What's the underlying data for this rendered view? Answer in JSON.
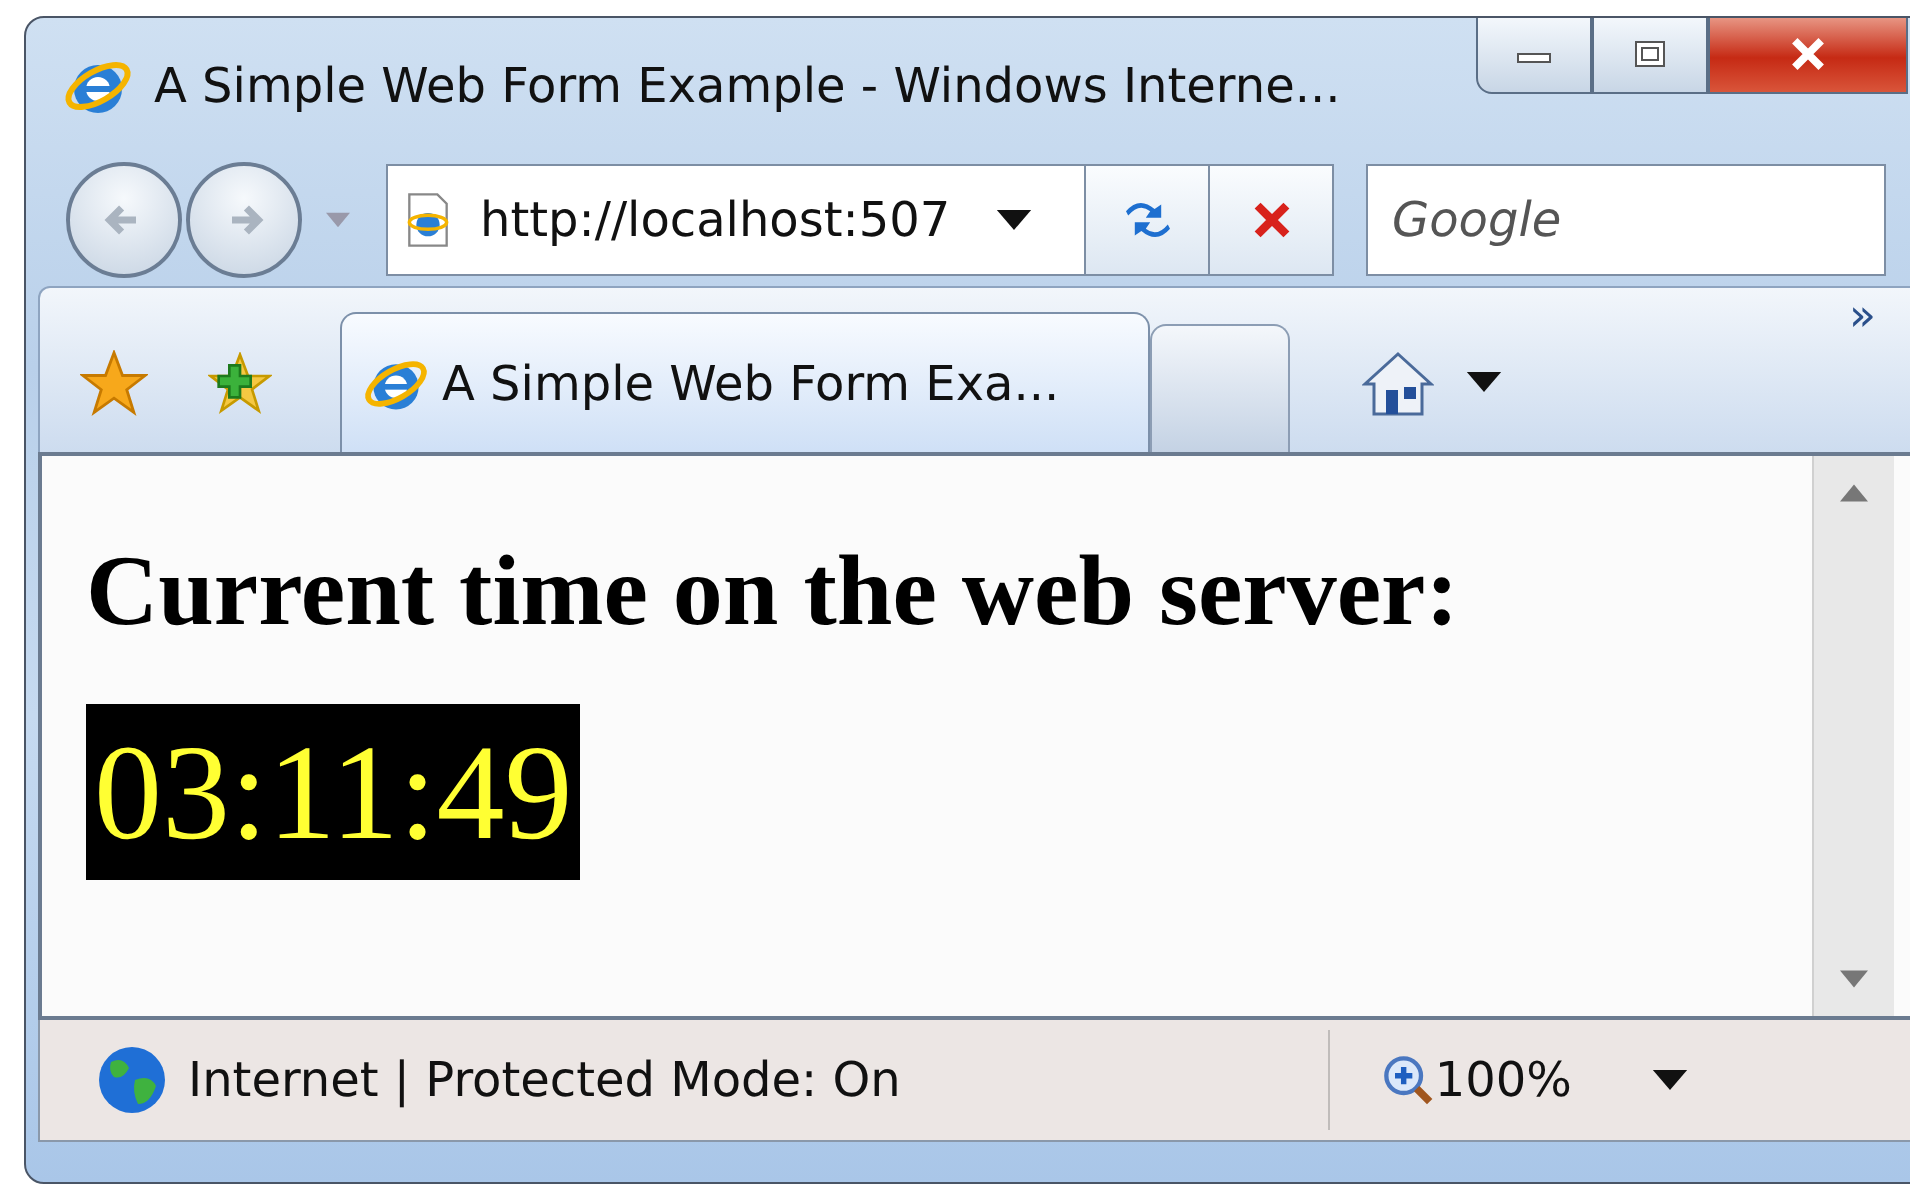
{
  "window": {
    "title": "A Simple Web Form Example - Windows Interne..."
  },
  "address_bar": {
    "value": "http://localhost:507"
  },
  "search": {
    "placeholder": "Google"
  },
  "tabs": [
    {
      "label": "A Simple Web Form Exa...",
      "selected": true
    }
  ],
  "toolbar": {
    "chevron": "»"
  },
  "page": {
    "heading": "Current time on the web server:",
    "time": "03:11:49"
  },
  "status_bar": {
    "zone": "Internet | Protected Mode: On",
    "zoom": "100%"
  }
}
